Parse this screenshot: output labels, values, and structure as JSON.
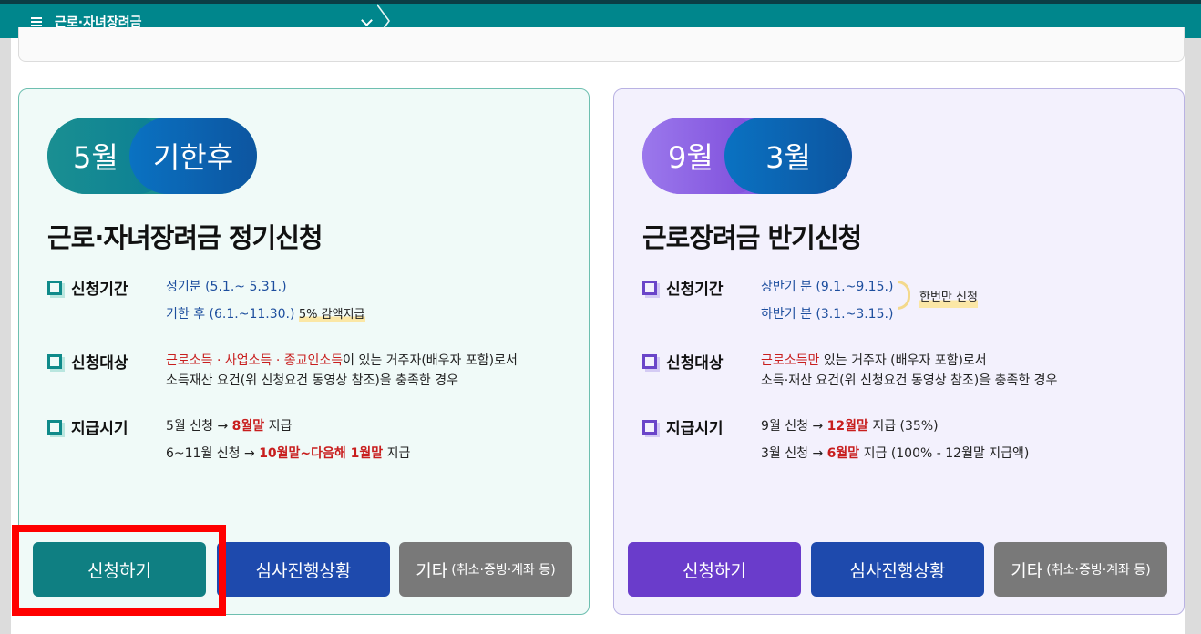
{
  "topbar": {
    "menu_label": "근로·자녀장려금"
  },
  "cards": [
    {
      "pill_a": "5월",
      "pill_b": "기한후",
      "title": "근로·자녀장려금 정기신청",
      "period": {
        "head": "신청기간",
        "line1": "정기분 (5.1.~ 5.31.)",
        "line2": "기한 후 (6.1.~11.30.)",
        "line2_note": "5% 감액지급"
      },
      "target": {
        "head": "신청대상",
        "red": "근로소득 · 사업소득 · 종교인소득",
        "rest": "이 있는 거주자(배우자 포함)로서",
        "line2": "소득재산 요건(위 신청요건 동영상 참조)을 충족한 경우"
      },
      "pay": {
        "head": "지급시기",
        "l1_pre": "5월 신청 → ",
        "l1_red": "8월말",
        "l1_post": " 지급",
        "l2_pre": "6~11월 신청 → ",
        "l2_red": "10월말~다음해 1월말",
        "l2_post": " 지급"
      },
      "buttons": {
        "apply": "신청하기",
        "status": "심사진행상황",
        "other": "기타",
        "other_note": "(취소·증빙·계좌 등)"
      }
    },
    {
      "pill_a": "9월",
      "pill_b": "3월",
      "title": "근로장려금 반기신청",
      "period": {
        "head": "신청기간",
        "line1": "상반기 분 (9.1.~9.15.)",
        "line2": "하반기 분 (3.1.~3.15.)",
        "note": "한번만 신청"
      },
      "target": {
        "head": "신청대상",
        "red": "근로소득만",
        "rest": " 있는 거주자 (배우자 포함)로서",
        "line2": "소득·재산 요건(위 신청요건 동영상 참조)을 충족한 경우"
      },
      "pay": {
        "head": "지급시기",
        "l1_pre": "9월 신청 → ",
        "l1_red": "12월말",
        "l1_post": " 지급 (35%)",
        "l2_pre": "3월 신청 → ",
        "l2_red": "6월말",
        "l2_post": " 지급 (100% - 12월말 지급액)"
      },
      "buttons": {
        "apply": "신청하기",
        "status": "심사진행상황",
        "other": "기타",
        "other_note": "(취소·증빙·계좌 등)"
      }
    }
  ],
  "colors": {
    "teal": "#0f7f82",
    "blue": "#1e4aad",
    "purple": "#6a3ccb",
    "gray": "#797979",
    "highlight_frame": "#ff0000"
  }
}
